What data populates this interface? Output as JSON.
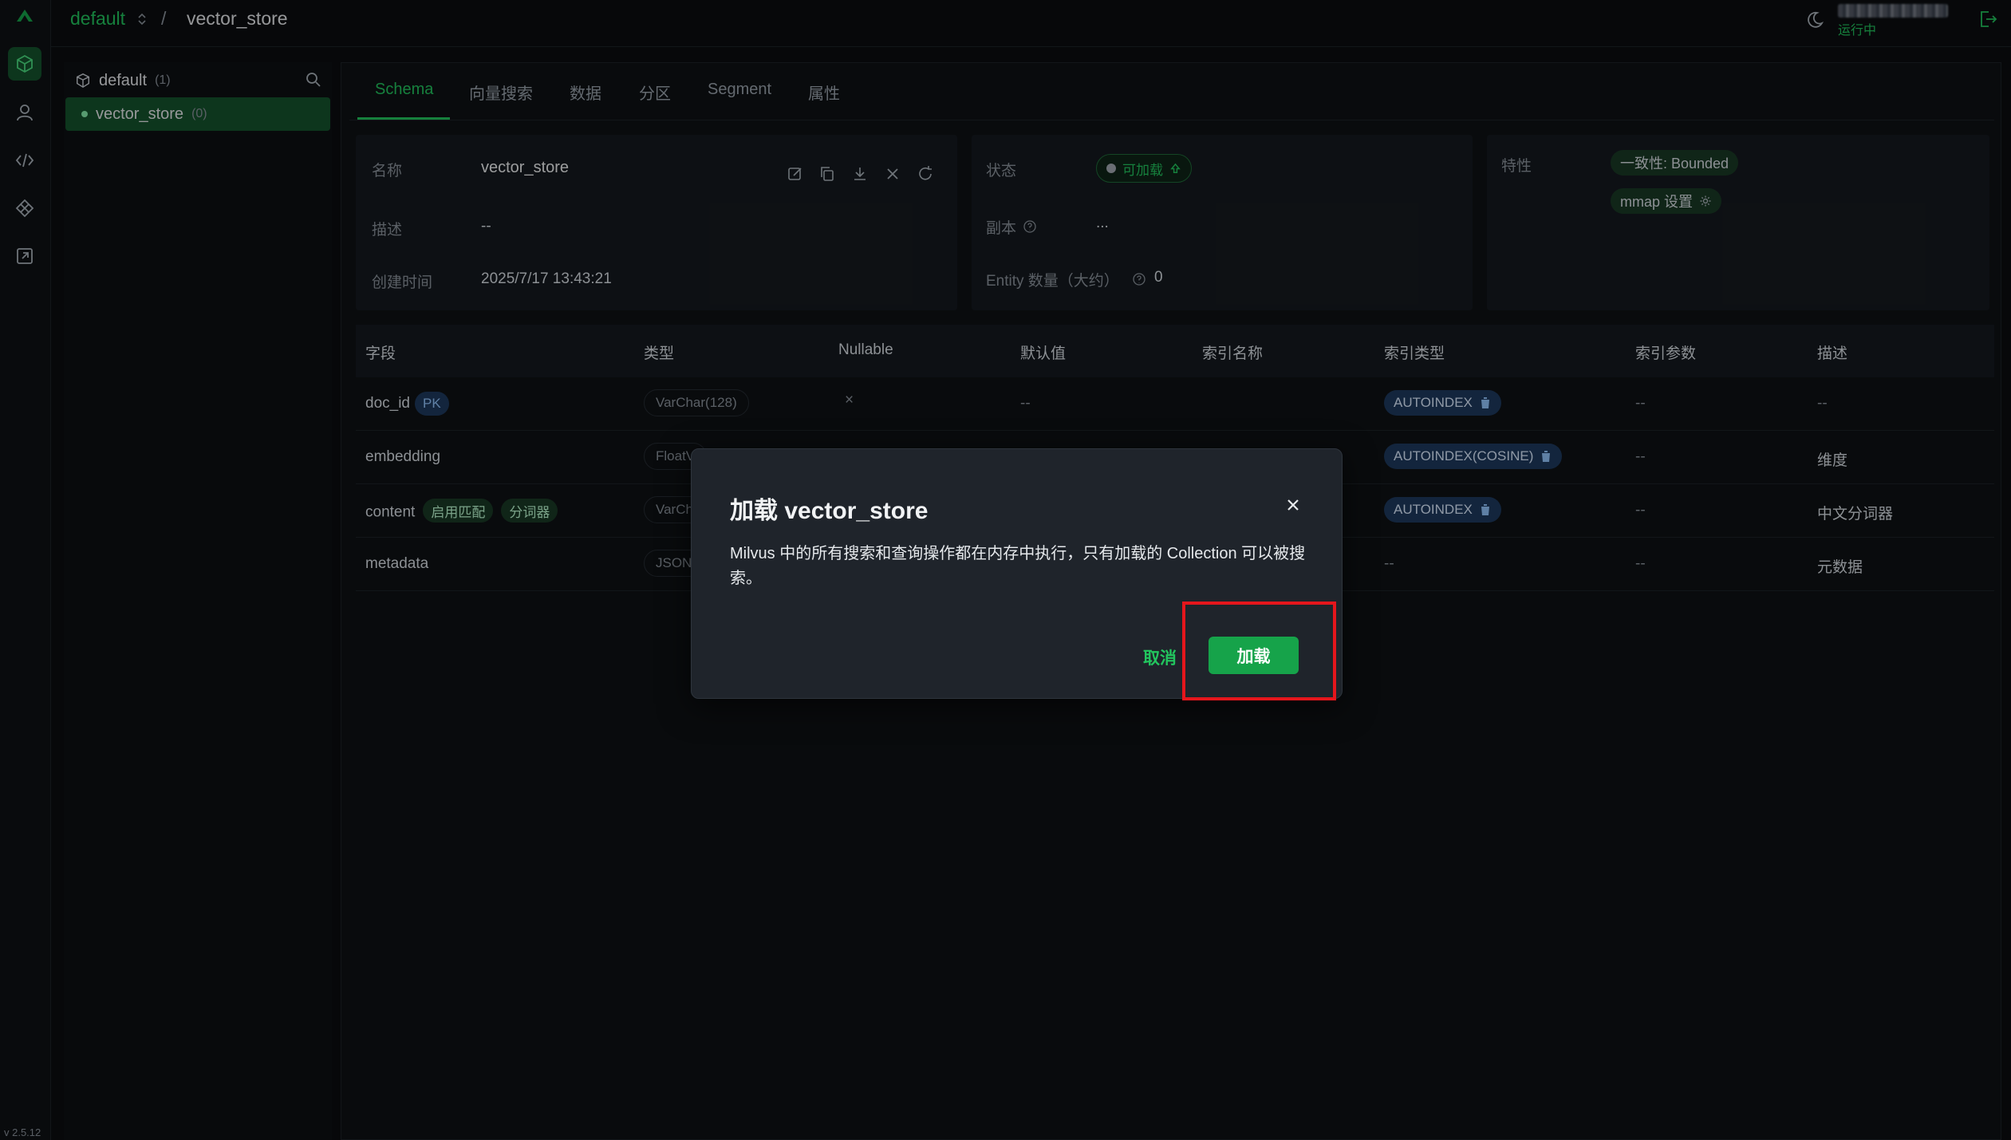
{
  "app": {
    "version": "v 2.5.12"
  },
  "header": {
    "database": "default",
    "separator": "/",
    "collection": "vector_store",
    "user_status": "运行中"
  },
  "tree": {
    "database": "default",
    "database_count": "(1)",
    "collection": "vector_store",
    "collection_count": "(0)"
  },
  "tabs": [
    "Schema",
    "向量搜索",
    "数据",
    "分区",
    "Segment",
    "属性"
  ],
  "info": {
    "name_label": "名称",
    "name_value": "vector_store",
    "desc_label": "描述",
    "desc_value": "--",
    "created_label": "创建时间",
    "created_value": "2025/7/17 13:43:21",
    "status_label": "状态",
    "status_value": "可加载",
    "replica_label": "副本",
    "replica_value": "...",
    "entity_label": "Entity 数量（大约）",
    "entity_value": "0",
    "features_label": "特性",
    "consistency": "一致性: Bounded",
    "mmap": "mmap 设置"
  },
  "table": {
    "headers": [
      "字段",
      "类型",
      "Nullable",
      "默认值",
      "索引名称",
      "索引类型",
      "索引参数",
      "描述"
    ],
    "rows": [
      {
        "field": "doc_id",
        "tag": "PK",
        "type": "VarChar(128)",
        "nullable": "×",
        "default": "--",
        "index_type": "AUTOINDEX",
        "params": "--",
        "desc": "--"
      },
      {
        "field": "embedding",
        "type": "FloatV",
        "index_type": "AUTOINDEX(COSINE)",
        "params": "--",
        "desc": "维度"
      },
      {
        "field": "content",
        "tags": [
          "启用匹配",
          "分词器"
        ],
        "type": "VarCh",
        "index_type": "AUTOINDEX",
        "params": "--",
        "desc": "中文分词器"
      },
      {
        "field": "metadata",
        "type": "JSON",
        "index_type": "--",
        "params": "--",
        "desc": "元数据"
      }
    ]
  },
  "modal": {
    "title": "加载 vector_store",
    "body": "Milvus 中的所有搜索和查询操作都在内存中执行，只有加载的 Collection 可以被搜索。",
    "cancel": "取消",
    "confirm": "加载"
  },
  "colors": {
    "accent": "#22c55e",
    "highlight": "#e5161c"
  }
}
